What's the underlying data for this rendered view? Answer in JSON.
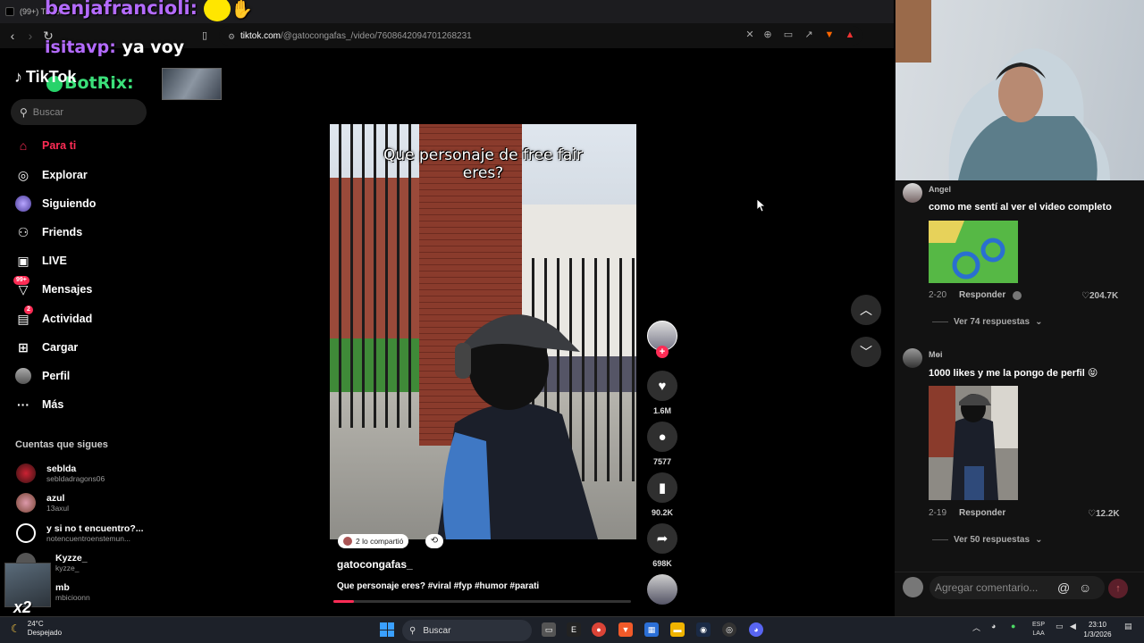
{
  "browser": {
    "tab_title": "(99+) TikTok",
    "url_host": "tiktok.com",
    "url_path": "/@gatocongafas_/video/7608642094701268231"
  },
  "chat": [
    {
      "user": "benjafrancioli:",
      "message": ""
    },
    {
      "user": "isitavp:",
      "message": "ya voy"
    },
    {
      "user": "BotRix:",
      "message": ""
    }
  ],
  "sidebar": {
    "logo": "TikTok",
    "search_placeholder": "Buscar",
    "items": [
      {
        "label": "Para ti",
        "icon": "home-icon",
        "active": true
      },
      {
        "label": "Explorar",
        "icon": "compass-icon"
      },
      {
        "label": "Siguiendo",
        "icon": "following-icon"
      },
      {
        "label": "Friends",
        "icon": "friends-icon"
      },
      {
        "label": "LIVE",
        "icon": "live-icon"
      },
      {
        "label": "Mensajes",
        "icon": "messages-icon",
        "badge": "99+"
      },
      {
        "label": "Actividad",
        "icon": "activity-icon",
        "badge": "2"
      },
      {
        "label": "Cargar",
        "icon": "upload-icon"
      },
      {
        "label": "Perfil",
        "icon": "profile-icon"
      },
      {
        "label": "Más",
        "icon": "more-icon"
      }
    ],
    "following_title": "Cuentas que sigues",
    "accounts": [
      {
        "name": "seblda",
        "handle": "sebldadragons06"
      },
      {
        "name": "azul",
        "handle": "13axul"
      },
      {
        "name": "y si no t encuentro?...",
        "handle": "notencuentroenstemun..."
      },
      {
        "name": "Kyzze_",
        "handle": "kyzze_"
      },
      {
        "name": "mb",
        "handle": "mbicioonn"
      }
    ],
    "multiplier": "x2"
  },
  "video": {
    "caption": "Que personaje de free fair eres?",
    "shared": "2 lo compartió",
    "author": "gatocongafas_",
    "description": "Que personaje eres? #viral #fyp #humor #parati",
    "progress": 0.07
  },
  "actions": {
    "likes": "1.6M",
    "comments": "7577",
    "saves": "90.2K",
    "shares": "698K"
  },
  "comments": [
    {
      "name": "Angel",
      "text": "como me sentí al ver el video completo",
      "date": "2-20",
      "reply": "Responder",
      "likes": "204.7K",
      "more": "Ver 74 respuestas"
    },
    {
      "name": "Mɵi",
      "text": "1000 likes y me la pongo de perfil 😝",
      "date": "2-19",
      "reply": "Responder",
      "likes": "12.2K",
      "more": "Ver 50 respuestas"
    }
  ],
  "comment_input": {
    "placeholder": "Agregar comentario..."
  },
  "taskbar": {
    "temp": "24°C",
    "weather": "Despejado",
    "search": "Buscar",
    "lang_top": "ESP",
    "lang_bottom": "LAA",
    "time": "23:10",
    "date": "1/3/2026"
  },
  "colors": {
    "accent": "#fe2c55",
    "chat_name": "#b46bff"
  }
}
